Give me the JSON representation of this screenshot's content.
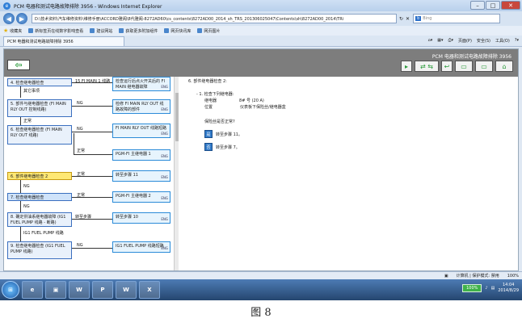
{
  "window": {
    "title": "PCM 电器和测试电路故障排除 3956 - Windows Internet Explorer",
    "controls": [
      "–",
      "□",
      "✕"
    ]
  },
  "address_bar": {
    "url": "D:\\技术资料\\汽车维修资料\\维修手册\\ACCORD雅阁\\8代雅阁-8272AD60\\cs_contents\\8272AD00_2014_sh_TRS_201306025047\\Contents\\sh\\8272AD00_2014\\TRi",
    "search_placeholder": "Bing",
    "search_badge": "b"
  },
  "favorites_bar": {
    "label": "收藏夹",
    "items": [
      "新标签页在线数字影响查看",
      "建议网站",
      "获取更多附加组件",
      "网页快讯库",
      "网页图片"
    ]
  },
  "tab": {
    "label": "PCM 电器和测试电路故障排除 3956",
    "commands": [
      "页面(P)",
      "安全(S)",
      "工具(O)"
    ]
  },
  "app": {
    "doc_title": "PCM 电器和测试电路故障排除 3956",
    "back_label": "⇦",
    "toolbar": [
      "▸",
      "⇄ ⇆",
      "↩",
      "▭",
      "▭",
      "⌂"
    ]
  },
  "flow": {
    "steps": [
      {
        "text": "4. 检查继电器检查"
      },
      {
        "text": "5. 部件与继电器检查 (FI MAIN RLY OUT 控制线路)"
      },
      {
        "text": "6. 检查继电器检查 (FI MAIN RLY OUT 线路)"
      },
      {
        "text": "6. 部件继电器检查 2"
      },
      {
        "text": "7. 检查继电器检查"
      },
      {
        "text": "8. 确定供油系继电器故障 (IG1 FUEL PUMP 线路 - 断路)"
      },
      {
        "text": "9. 检查继电器检查 (IG1 FUEL PUMP 线路)"
      }
    ],
    "results": [
      {
        "text": "检查运行后点火开关后的 FI MAIN 继电器故障",
        "tag": "ENG"
      },
      {
        "text": "检修 FI MAIN RLY OUT 线路故障的部件",
        "tag": "ENG"
      },
      {
        "text": "FI MAIN RLY OUT 线路短路",
        "tag": "ENG"
      },
      {
        "text": "PGM-FI 主继电器 1",
        "tag": "ENG"
      },
      {
        "text": "转至步骤 11",
        "tag": "ENG"
      },
      {
        "text": "PGM-FI 主继电器 2",
        "tag": "ENG"
      },
      {
        "text": "转至步骤 10",
        "tag": "ENG"
      },
      {
        "text": "IG1 FUEL PUMP 线路短路",
        "tag": "ENG"
      }
    ],
    "labels": {
      "top_line": "15 FI MAIN 1 线路",
      "l1": "其它事项",
      "ng1": "NG",
      "ok1": "正常",
      "ng2": "NG",
      "ok2": "正常",
      "ok3": "正常",
      "ng3": "NG",
      "ok4": "正常",
      "ng4": "NG",
      "ok5": "正常",
      "ng5": "转至步骤",
      "line_ig": "IG1 FUEL PUMP 线路",
      "ng6": "NG"
    }
  },
  "detail": {
    "title": "6. 部件继电器检查 2:",
    "sub": "- 1. 检查下列继电器:",
    "rows": [
      {
        "k": "继电器",
        "v": "8# 号 (20 A)"
      },
      {
        "k": "位置",
        "v": "仪表板下保险丝/继电器盒"
      }
    ],
    "question": "保险丝是否正常?",
    "answers": [
      {
        "key": "是",
        "text": "转至步骤 11。"
      },
      {
        "key": "否",
        "text": "转至步骤 7。"
      }
    ]
  },
  "status_bar": {
    "zone": "计算机 | 保护模式: 禁用",
    "zoom": "100%"
  },
  "taskbar": {
    "start_label": "⊞",
    "apps": [
      "e",
      "▣",
      "W",
      "P",
      "W",
      "X"
    ],
    "tray_pct": "100%",
    "time": "14:04",
    "date": "2014/8/29"
  },
  "caption": "图 8"
}
